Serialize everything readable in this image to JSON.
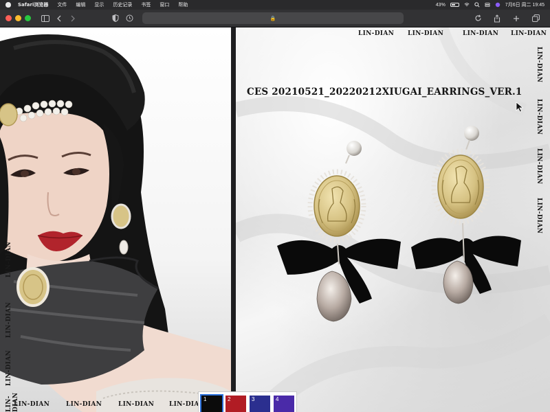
{
  "menubar": {
    "app_name": "Safari浏览器",
    "items": [
      "文件",
      "编辑",
      "显示",
      "历史记录",
      "书签",
      "窗口",
      "帮助"
    ],
    "battery_percent": "43%",
    "datetime": "7月6日 周二 19:45"
  },
  "toolbar": {
    "traffic_lights": {
      "close": "#ff5f57",
      "minimize": "#febc2e",
      "zoom": "#28c840"
    },
    "lock_glyph": "🔒"
  },
  "watermark": "LIN-DIAN",
  "product": {
    "title": "CES 20210521_20220212XIUGAI_EARRINGS_VER.1"
  },
  "swatches": [
    {
      "number": "1",
      "color": "#0b0b0b",
      "selected": true
    },
    {
      "number": "2",
      "color": "#b11c24",
      "selected": false
    },
    {
      "number": "3",
      "color": "#2b2f8f",
      "selected": false
    },
    {
      "number": "4",
      "color": "#4a2aa8",
      "selected": false
    }
  ],
  "colors": {
    "coin_gold": "#d8c48a",
    "pearl": "#e6e3de",
    "bow": "#0a0a0a",
    "drop_pearl": "#bcb0a8"
  }
}
